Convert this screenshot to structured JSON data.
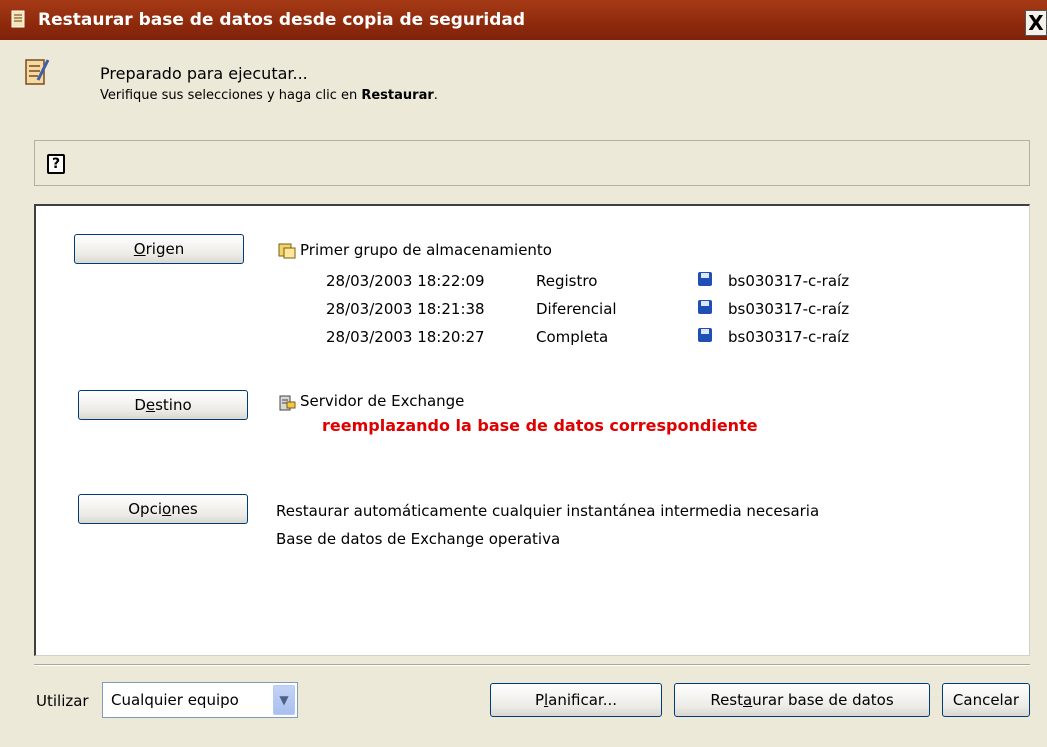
{
  "window": {
    "title": "Restaurar base de datos desde copia de seguridad",
    "close_label": "X",
    "app_icon": "restore-document-icon"
  },
  "header": {
    "icon": "notepad-edit-icon",
    "status": "Preparado para ejecutar...",
    "instruction_prefix": "Verifique sus selecciones y haga clic en ",
    "instruction_action": "Restaurar",
    "instruction_suffix": "."
  },
  "help": {
    "icon": "help-question-icon",
    "label": "?"
  },
  "source": {
    "button_pre": "",
    "button_mnemonic": "O",
    "button_post": "rigen",
    "storage_group": "Primer grupo de almacenamiento",
    "backups": [
      {
        "datetime": "28/03/2003 18:22:09",
        "type": "Registro",
        "media": "bs030317-c-raíz"
      },
      {
        "datetime": "28/03/2003 18:21:38",
        "type": "Diferencial",
        "media": "bs030317-c-raíz"
      },
      {
        "datetime": "28/03/2003 18:20:27",
        "type": "Completa",
        "media": "bs030317-c-raíz"
      }
    ]
  },
  "destination": {
    "button_pre": "D",
    "button_mnemonic": "e",
    "button_post": "stino",
    "server": "Servidor de Exchange",
    "note": "reemplazando la base de datos correspondiente",
    "note_color": "#e00000"
  },
  "options": {
    "button_pre": "Opci",
    "button_mnemonic": "o",
    "button_post": "nes",
    "lines": [
      "Restaurar automáticamente cualquier instantánea intermedia necesaria",
      "Base de datos de Exchange operativa"
    ]
  },
  "footer": {
    "use_label": "Utilizar",
    "use_value": "Cualquier equipo",
    "schedule_pre": "P",
    "schedule_mnemonic": "l",
    "schedule_post": "anificar...",
    "restore_pre": "Rest",
    "restore_mnemonic": "a",
    "restore_post": "urar base de datos",
    "cancel_label": "Cancelar"
  },
  "colors": {
    "titlebar": "#8e2a0c",
    "dialog_bg": "#ece9d8",
    "warning": "#e00000"
  }
}
